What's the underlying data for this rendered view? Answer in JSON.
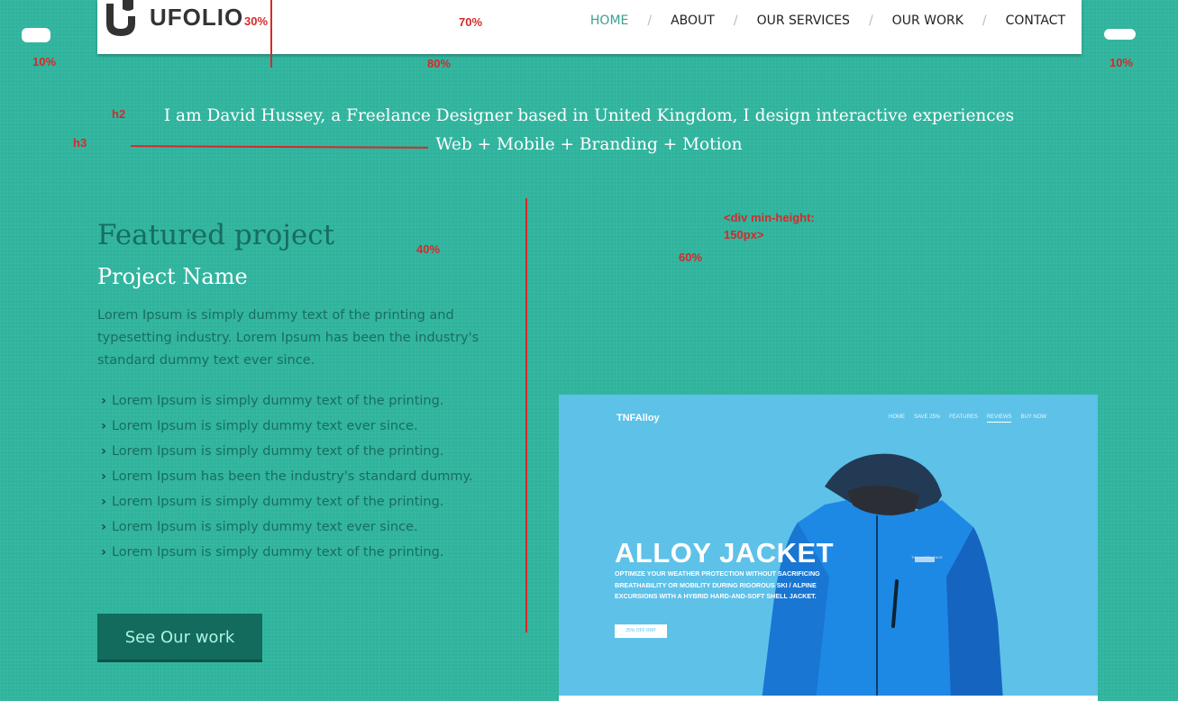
{
  "header": {
    "logo_text": "UFOLIO",
    "nav": [
      {
        "label": "HOME",
        "active": true
      },
      {
        "label": "ABOUT"
      },
      {
        "label": "OUR SERVICES"
      },
      {
        "label": "OUR WORK"
      },
      {
        "label": "CONTACT"
      }
    ]
  },
  "hero": {
    "h2": "I am David Hussey, a Freelance Designer based in United Kingdom, I design interactive experiences",
    "h3": "Web + Mobile + Branding + Motion"
  },
  "featured": {
    "title": "Featured project",
    "project_name": "Project Name",
    "description": "Lorem Ipsum is simply dummy text of the printing and typesetting industry. Lorem Ipsum has been the industry's standard dummy text ever since.",
    "bullets": [
      "Lorem Ipsum is simply dummy text of the printing.",
      "Lorem Ipsum is simply dummy text ever since.",
      "Lorem Ipsum is simply dummy text of the printing.",
      "Lorem Ipsum has been the industry's standard dummy.",
      "Lorem Ipsum is simply dummy text of the printing.",
      "Lorem Ipsum is simply dummy text ever since.",
      "Lorem Ipsum is simply dummy text of the printing."
    ],
    "button_label": "See Our work"
  },
  "mockup": {
    "logo": "TNFAlloy",
    "nav": [
      "HOME",
      "SAVE 25%",
      "FEATURES",
      "REVIEWS",
      "BUY NOW"
    ],
    "title": "ALLOY JACKET",
    "subtitle": "OPTIMIZE YOUR WEATHER PROTECTION WITHOUT SACRIFICING BREATHABILITY OR MOBILITY DURING RIGOROUS SKI / ALPINE EXCURSIONS WITH A HYBRID HARD-AND-SOFT SHELL JACKET.",
    "button_label": "25% OFF RRP",
    "brand_mark": "THE NORTH FACE"
  },
  "annotations": {
    "logo_pct": "30%",
    "nav_pct": "70%",
    "left_margin": "10%",
    "right_margin": "10%",
    "header_width": "80%",
    "h2_tag": "h2",
    "h3_tag": "h3",
    "left_col": "40%",
    "right_col": "60%",
    "min_height_note_1": "<div min-height:",
    "min_height_note_2": "150px>"
  },
  "colors": {
    "page_bg": "#2fb39d",
    "header_bg": "#ffffff",
    "nav_active": "#3aa18f",
    "button_bg": "#136b5d",
    "mockup_bg": "#5ec1e8",
    "jacket": "#1e88e5",
    "annotation": "#d42a2a"
  }
}
